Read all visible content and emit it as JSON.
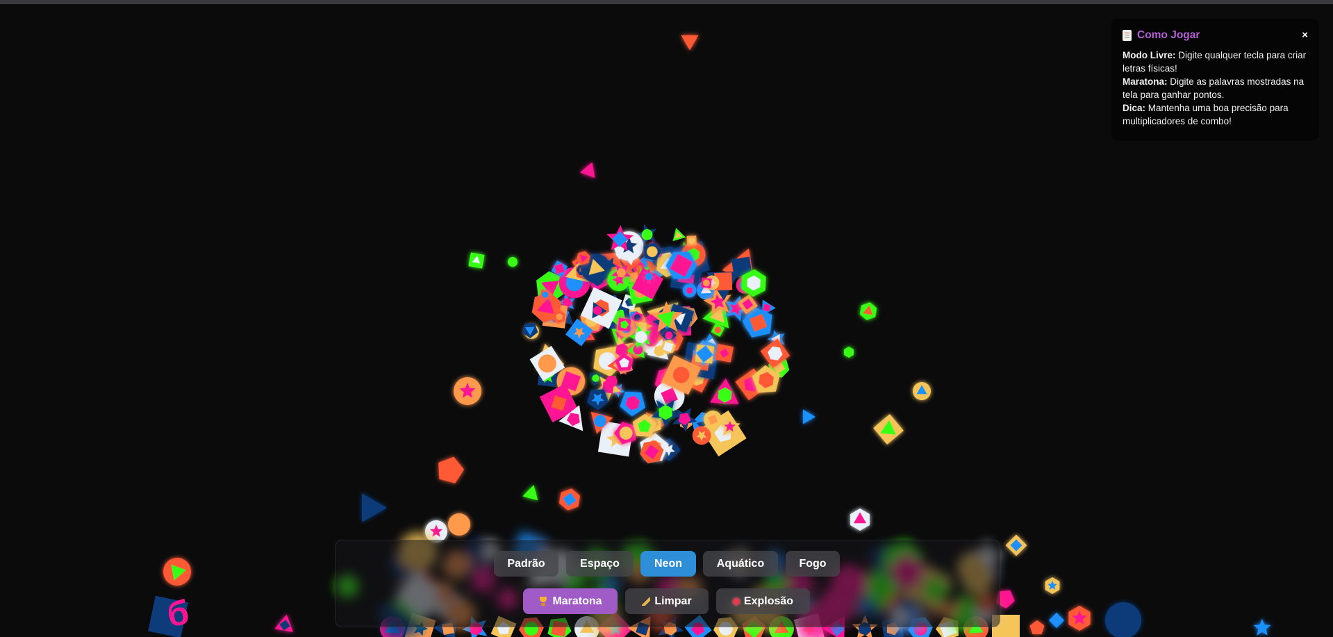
{
  "help": {
    "icon": "document-icon",
    "title": "Como Jogar",
    "close": "×",
    "rows": [
      {
        "label": "Modo Livre:",
        "text": " Digite qualquer tecla para criar letras físicas!"
      },
      {
        "label": "Maratona:",
        "text": " Digite as palavras mostradas na tela para ganhar pontos."
      },
      {
        "label": "Dica:",
        "text": " Mantenha uma boa precisão para multiplicadores de combo!"
      }
    ]
  },
  "themes": [
    {
      "label": "Padrão",
      "active": false
    },
    {
      "label": "Espaço",
      "active": false
    },
    {
      "label": "Neon",
      "active": true
    },
    {
      "label": "Aquático",
      "active": false
    },
    {
      "label": "Fogo",
      "active": false
    }
  ],
  "actions": [
    {
      "label": "Maratona",
      "icon": "trophy-icon"
    },
    {
      "label": "Limpar",
      "icon": "broom-icon"
    },
    {
      "label": "Explosão",
      "icon": "bomb-icon"
    }
  ],
  "canvas_letter": "б",
  "colors": {
    "pink": "#ff1493",
    "blue": "#1e90ff",
    "green": "#39ff14",
    "orange": "#ff9a4d",
    "coral": "#ff5a36",
    "yellow": "#f5c55a",
    "white": "#e9f0f7",
    "navy": "#0e3b7a",
    "active_theme": "#2f8ed8",
    "marathon": "#a05bc7"
  }
}
